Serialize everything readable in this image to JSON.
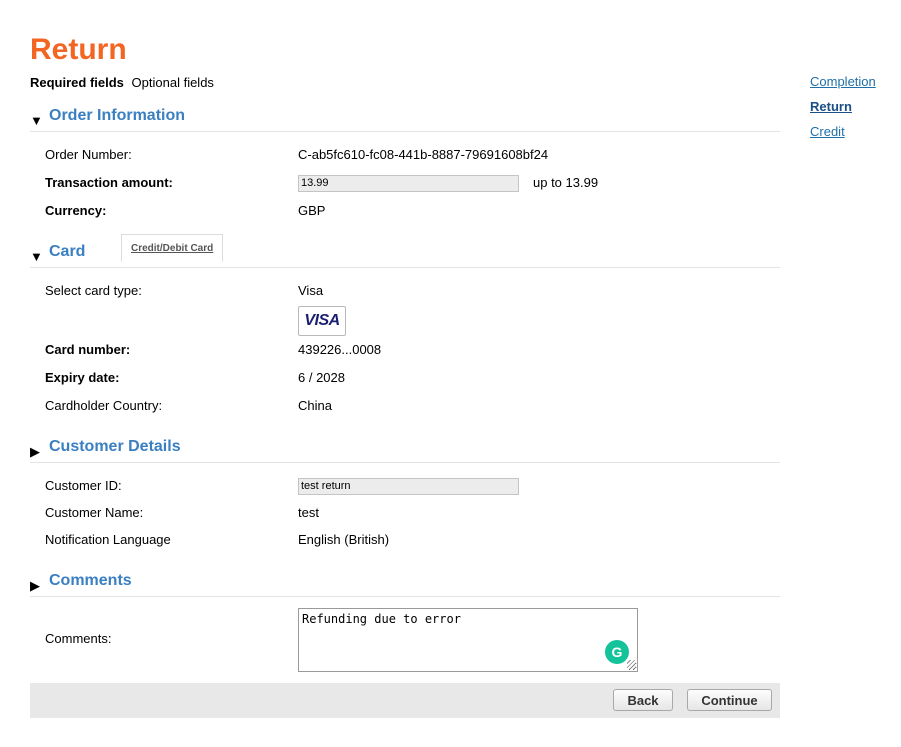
{
  "page": {
    "title": "Return"
  },
  "legend": {
    "required": "Required fields",
    "optional": "Optional fields"
  },
  "side_nav": {
    "items": [
      "Completion",
      "Return",
      "Credit"
    ],
    "active": "Return"
  },
  "order": {
    "section_title": "Order Information",
    "order_number_label": "Order Number:",
    "order_number": "C-ab5fc610-fc08-441b-8887-79691608bf24",
    "amount_label": "Transaction amount:",
    "amount_value": "13.99",
    "amount_max": "up to 13.99",
    "currency_label": "Currency:",
    "currency": "GBP"
  },
  "card": {
    "section_title": "Card",
    "tab_label": "Credit/Debit Card",
    "type_label": "Select card type:",
    "type_value": "Visa",
    "logo_text": "VISA",
    "number_label": "Card number:",
    "number": "439226...0008",
    "expiry_label": "Expiry date:",
    "expiry": "6 / 2028",
    "country_label": "Cardholder Country:",
    "country": "China"
  },
  "customer": {
    "section_title": "Customer Details",
    "id_label": "Customer ID:",
    "id_value": "test return",
    "name_label": "Customer Name:",
    "name": "test",
    "lang_label": "Notification Language",
    "lang": "English (British)"
  },
  "comments": {
    "section_title": "Comments",
    "label": "Comments:",
    "value": "Refunding due to error",
    "grammarly_glyph": "G"
  },
  "buttons": {
    "back": "Back",
    "continue": "Continue"
  },
  "icons": {
    "expanded": "▼",
    "collapsed": "▶"
  },
  "colors": {
    "title": "#f26522",
    "section": "#3a7fc1",
    "link": "#1f6fa8"
  }
}
